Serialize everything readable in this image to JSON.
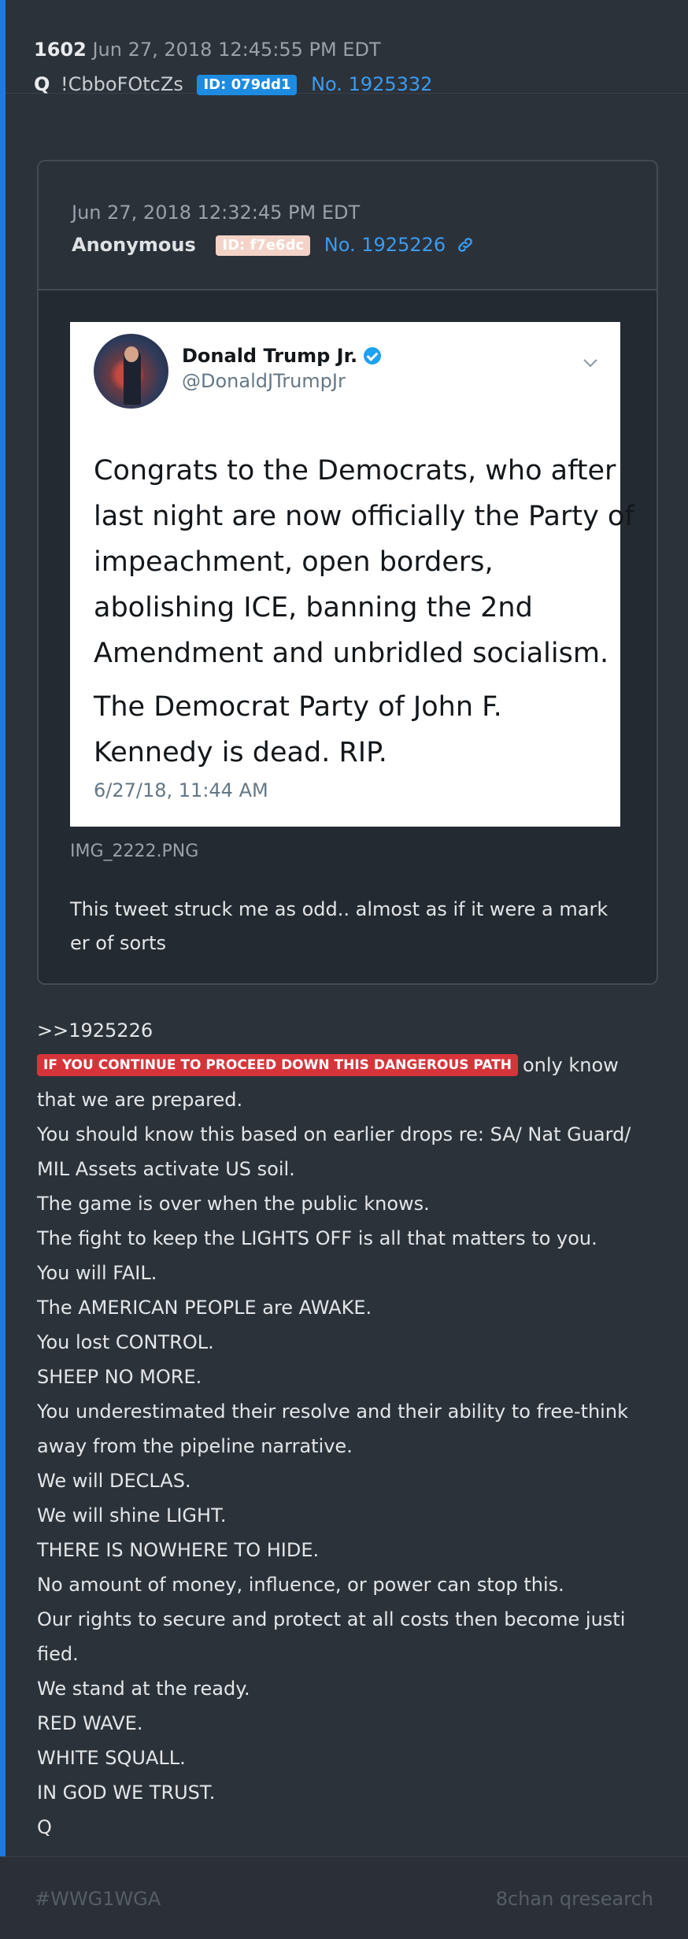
{
  "post": {
    "number": "1602",
    "date": "Jun 27, 2018 12:45:55 PM EDT",
    "name": "Q",
    "tripcode": "!CbboFOtcZs",
    "id": "ID: 079dd1",
    "post_no": "No. 1925332"
  },
  "quoted": {
    "date": "Jun 27, 2018 12:32:45 PM EDT",
    "author": "Anonymous",
    "id": "ID: f7e6dc",
    "post_no": "No. 1925226",
    "tweet": {
      "name": "Donald Trump Jr.",
      "handle": "@DonaldJTrumpJr",
      "lines": [
        "Congrats to the Democrats, who after",
        "last night are now officially the Party of",
        "impeachment, open borders,",
        "abolishing ICE, banning the 2nd",
        "Amendment and unbridled socialism."
      ],
      "lines2": [
        "The Democrat Party of John F.",
        "Kennedy is dead. RIP."
      ],
      "time": "6/27/18, 11:44 AM"
    },
    "filename": "IMG_2222.PNG",
    "comment": [
      "This tweet struck me as odd.. almost as if it were a mark",
      "er of sorts"
    ]
  },
  "body": {
    "reply_ref": ">>1925226",
    "red_tag": "IF YOU CONTINUE TO PROCEED DOWN THIS DANGEROUS PATH",
    "after_tag": "only know",
    "lines": [
      "that we are prepared.",
      "You should know this based on earlier drops re: SA/ Nat Guard/",
      "MIL Assets activate US soil.",
      "The game is over when the public knows.",
      "The fight to keep the LIGHTS OFF is all that matters to you.",
      "You will FAIL.",
      "The AMERICAN PEOPLE are AWAKE.",
      "You lost CONTROL.",
      "SHEEP NO MORE.",
      "You underestimated their resolve and their ability to free-think",
      "away from the pipeline narrative.",
      "We will DECLAS.",
      "We will shine LIGHT.",
      "THERE IS NOWHERE TO HIDE.",
      "No amount of money, influence, or power can stop this.",
      "Our rights to secure and protect at all costs then become justi",
      "fied.",
      "We stand at the ready.",
      "RED WAVE.",
      "WHITE SQUALL.",
      "IN GOD WE TRUST.",
      "Q"
    ]
  },
  "footer": {
    "hashtag": "#WWG1WGA",
    "source": "8chan qresearch"
  },
  "colors": {
    "accent_bar": "#1e7ae0",
    "link": "#3a9cf0",
    "red_tag": "#d5353a",
    "id_badge": "#1d8be0"
  }
}
